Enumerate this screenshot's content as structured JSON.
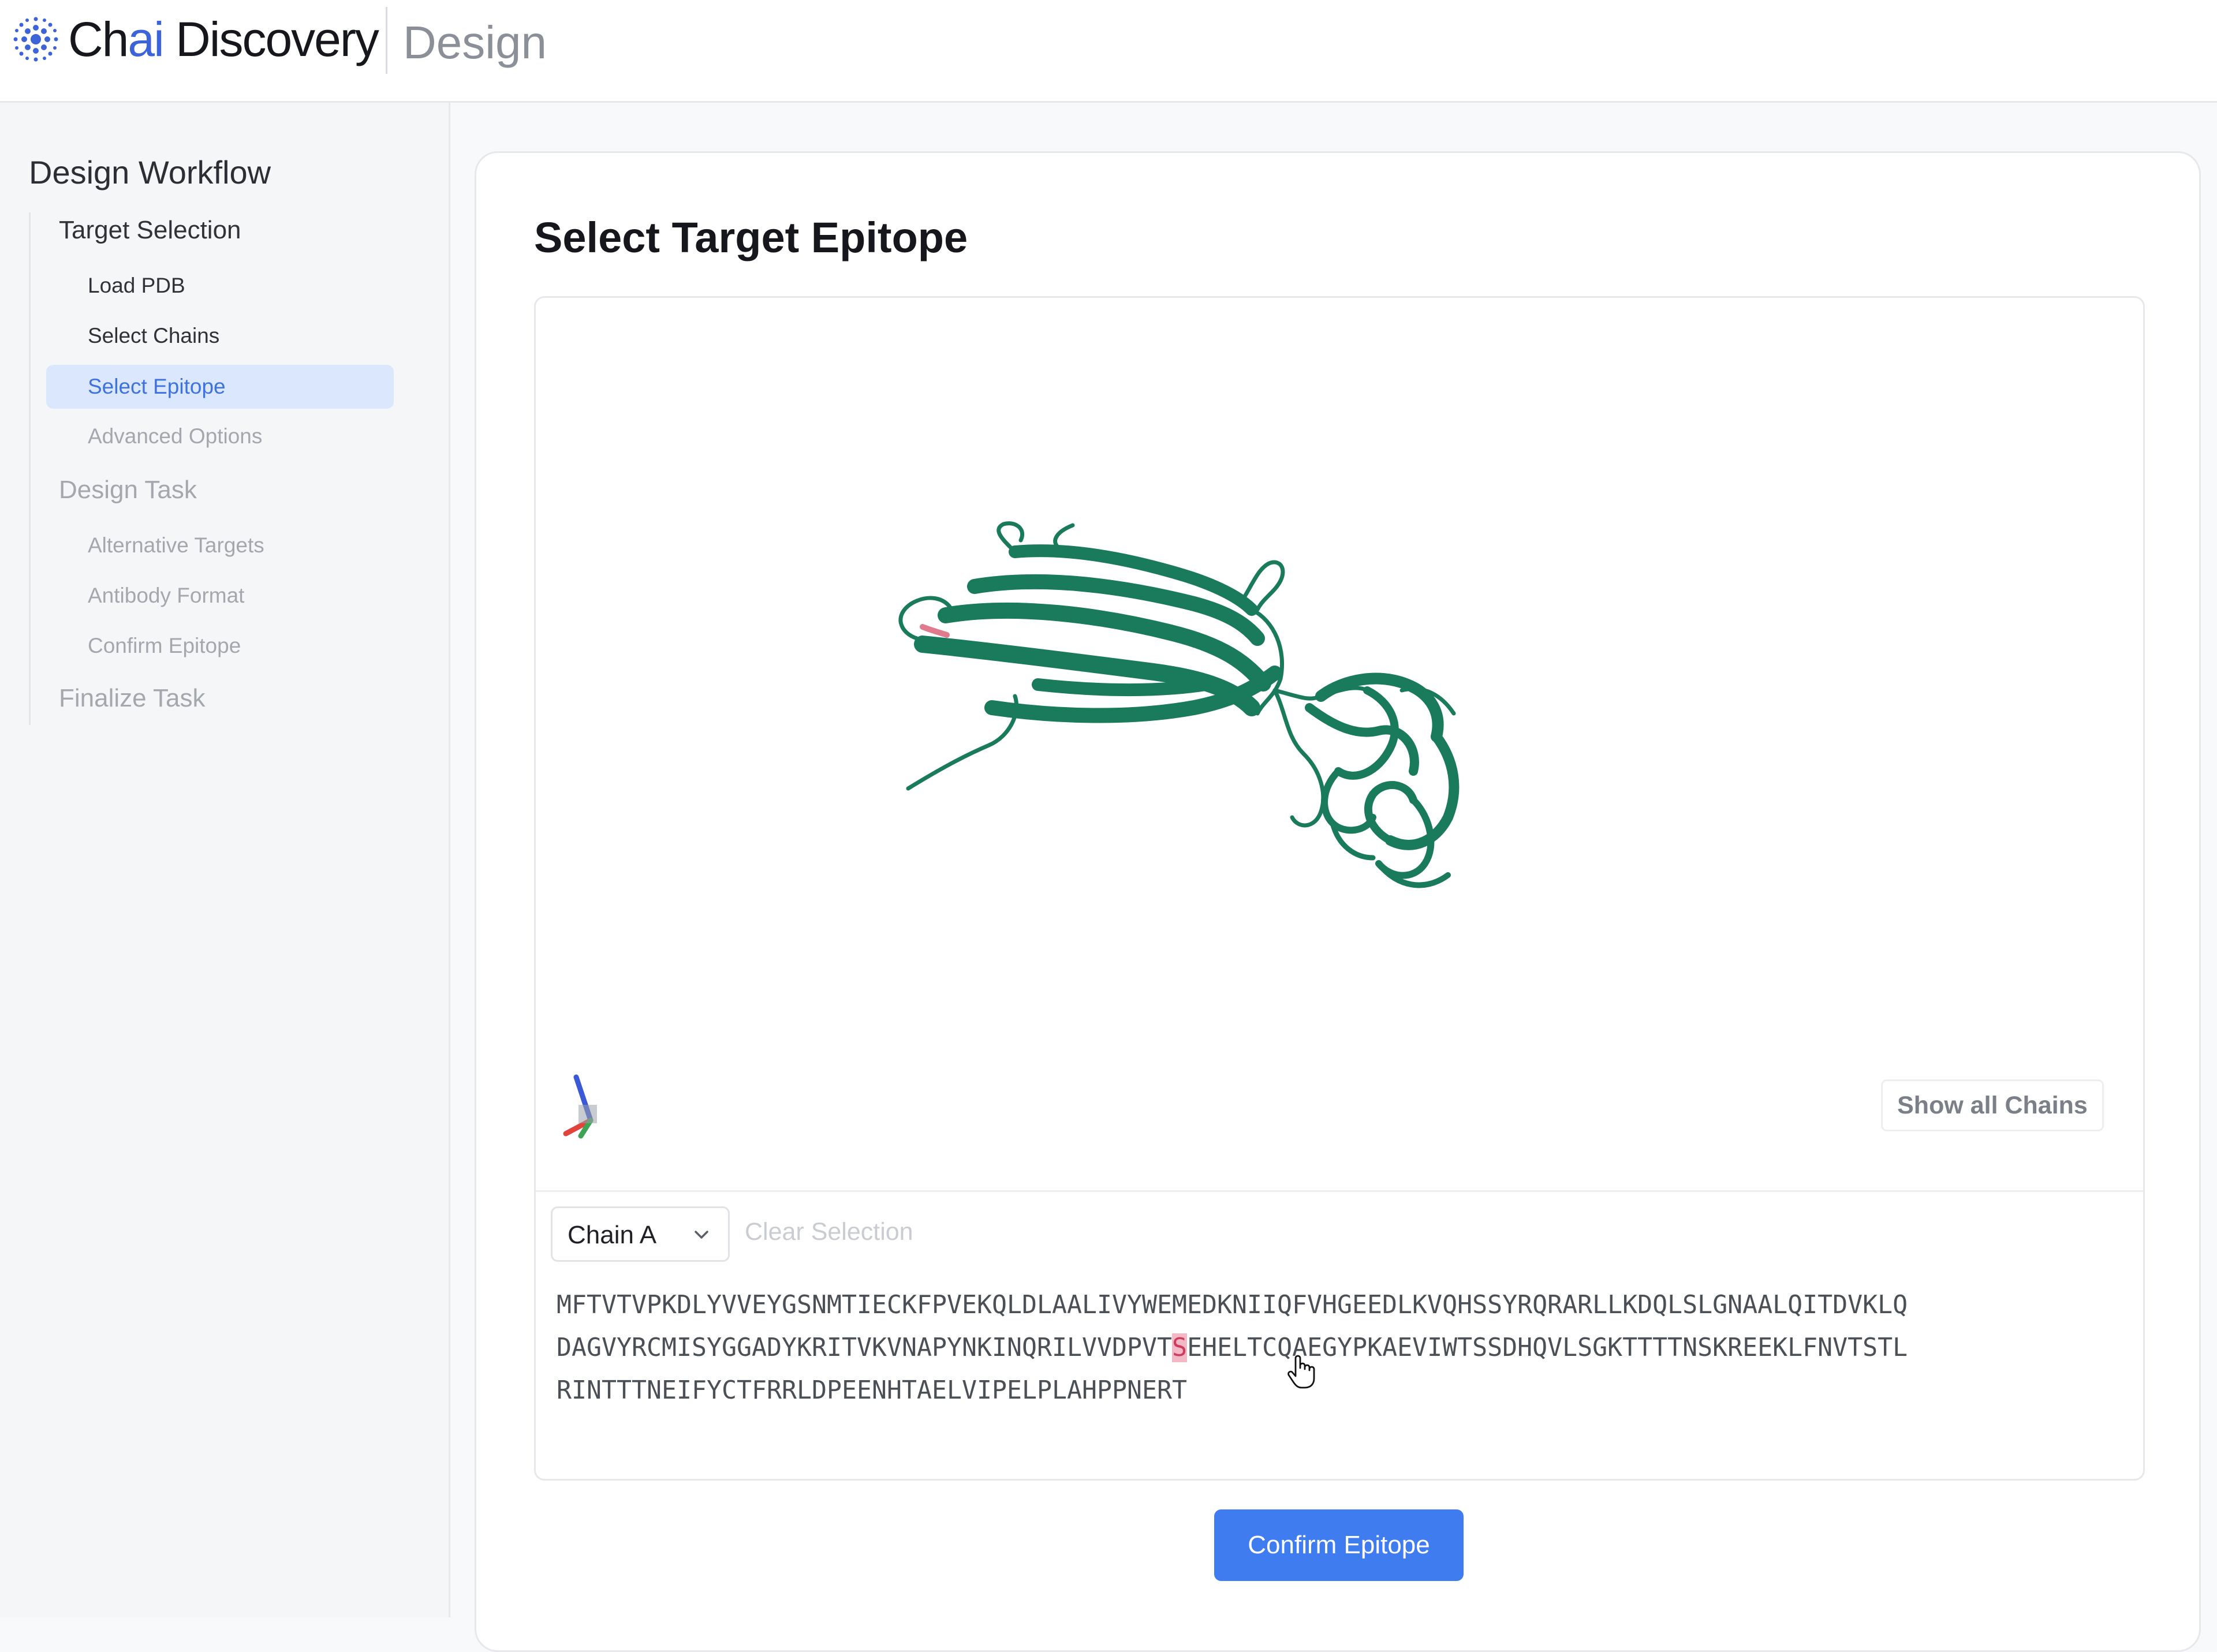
{
  "header": {
    "brand_prefix": "Ch",
    "brand_highlight": "ai",
    "brand_suffix": " Discovery",
    "product": "Design",
    "logo_icon": "chai-logo-icon"
  },
  "sidebar": {
    "title": "Design Workflow",
    "sections": [
      {
        "label": "Target Selection",
        "state": "done",
        "items": [
          {
            "label": "Load PDB",
            "state": "done"
          },
          {
            "label": "Select Chains",
            "state": "done"
          },
          {
            "label": "Select Epitope",
            "state": "active"
          },
          {
            "label": "Advanced Options",
            "state": "future"
          }
        ]
      },
      {
        "label": "Design Task",
        "state": "future",
        "items": [
          {
            "label": "Alternative Targets",
            "state": "future"
          },
          {
            "label": "Antibody Format",
            "state": "future"
          },
          {
            "label": "Confirm Epitope",
            "state": "future"
          }
        ]
      },
      {
        "label": "Finalize Task",
        "state": "future",
        "items": []
      }
    ]
  },
  "main": {
    "title": "Select Target Epitope",
    "viewer": {
      "show_all_chains_label": "Show all Chains",
      "structure_color": "#1a7a5c",
      "epitope_color": "#e07a8c",
      "axis_colors": {
        "x": "#e0443c",
        "y": "#3fa356",
        "z": "#3b59d4"
      }
    },
    "chain_select": {
      "value": "Chain A",
      "icon": "chevron-down-icon"
    },
    "clear_selection_label": "Clear Selection",
    "sequence": {
      "line1": "MFTVTVPKDLYVVEYGSNMTIECKFPVEKQLDLAALIVYWEMEDKNIIQFVHGEEDLKVQHSSYRQRARLLKDQLSLGNAALQITDVKLQ",
      "line2_before": "DAGVYRCMISYGGADYKRITVKVNAPYNKINQRILVVDPVT",
      "line2_selected": "S",
      "line2_after": "EHELTCQAEGYPKAEVIWTSSDHQVLSGKTTTTNSKREEKLFNVTSTL",
      "line3": "RINTTTNEIFYCTFRRLDPEENHTAELVIPELPLAHPPNERT"
    },
    "confirm_label": "Confirm Epitope"
  }
}
